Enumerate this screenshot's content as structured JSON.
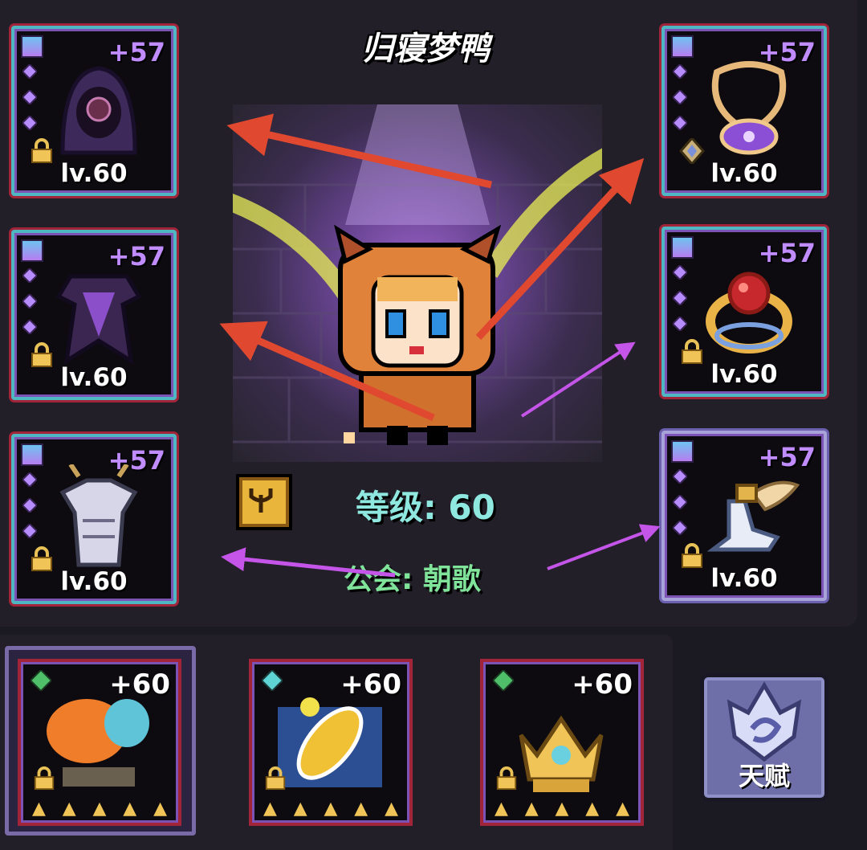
{
  "character": {
    "name": "归寝梦鸭",
    "level_text": "等级: 60",
    "guild_text": "公会: 朝歌"
  },
  "equipment_left": [
    {
      "slot": "helmet",
      "enhance": "+57",
      "level": "lv.60",
      "icon": "hood-helmet-icon"
    },
    {
      "slot": "armor",
      "enhance": "+57",
      "level": "lv.60",
      "icon": "dark-armor-icon"
    },
    {
      "slot": "legs",
      "enhance": "+57",
      "level": "lv.60",
      "icon": "silver-armor-icon"
    }
  ],
  "equipment_right": [
    {
      "slot": "necklace",
      "enhance": "+57",
      "level": "lv.60",
      "icon": "amulet-icon"
    },
    {
      "slot": "ring",
      "enhance": "+57",
      "level": "lv.60",
      "icon": "ruby-ring-icon"
    },
    {
      "slot": "boots",
      "enhance": "+57",
      "level": "lv.60",
      "icon": "winged-boots-icon"
    }
  ],
  "bottom_items": [
    {
      "enhance": "+60",
      "icon": "fire-bird-icon",
      "stars": 5
    },
    {
      "enhance": "+60",
      "icon": "golden-disc-icon",
      "stars": 5
    },
    {
      "enhance": "+60",
      "icon": "crown-icon",
      "stars": 5
    }
  ],
  "talent": {
    "label": "天赋"
  },
  "colors": {
    "background": "#1b1921",
    "panel": "#221f29",
    "enhance_purple": "#c08cff",
    "level_cyan": "#8fe8e0",
    "guild_green": "#7fe39a",
    "arrow_red": "#e0492f",
    "arrow_violet": "#c455e8"
  }
}
